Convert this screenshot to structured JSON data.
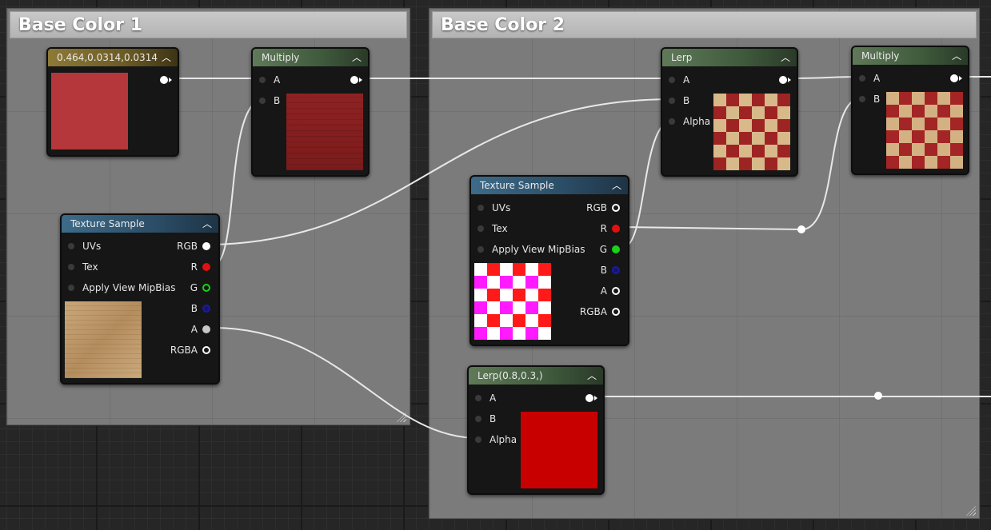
{
  "comments": {
    "base_color_1": "Base Color 1",
    "base_color_2": "Base Color 2"
  },
  "nodes": {
    "constant": {
      "title": "0.464,0.0314,0.0314",
      "color": "#b5373b"
    },
    "multiply1": {
      "title": "Multiply",
      "pin_a": "A",
      "pin_b": "B"
    },
    "texture1": {
      "title": "Texture Sample",
      "inputs": [
        "UVs",
        "Tex",
        "Apply View MipBias"
      ],
      "outputs": [
        "RGB",
        "R",
        "G",
        "B",
        "A",
        "RGBA"
      ]
    },
    "lerp1": {
      "title": "Lerp",
      "pin_a": "A",
      "pin_b": "B",
      "pin_alpha": "Alpha"
    },
    "multiply2": {
      "title": "Multiply",
      "pin_a": "A",
      "pin_b": "B"
    },
    "texture2": {
      "title": "Texture Sample",
      "inputs": [
        "UVs",
        "Tex",
        "Apply View MipBias"
      ],
      "outputs": [
        "RGB",
        "R",
        "G",
        "B",
        "A",
        "RGBA"
      ]
    },
    "lerp2": {
      "title": "Lerp(0.8,0.3,)",
      "pin_a": "A",
      "pin_b": "B",
      "pin_alpha": "Alpha",
      "color": "#c90000"
    }
  },
  "pin_colors": {
    "r": "#e31010",
    "g": "#19d219",
    "b": "#1a1aa8",
    "white": "#ffffff",
    "grey": "#c8c8c8"
  },
  "icons": {
    "collapse": "chevron-up-icon",
    "resize": "resize-grip-icon"
  }
}
